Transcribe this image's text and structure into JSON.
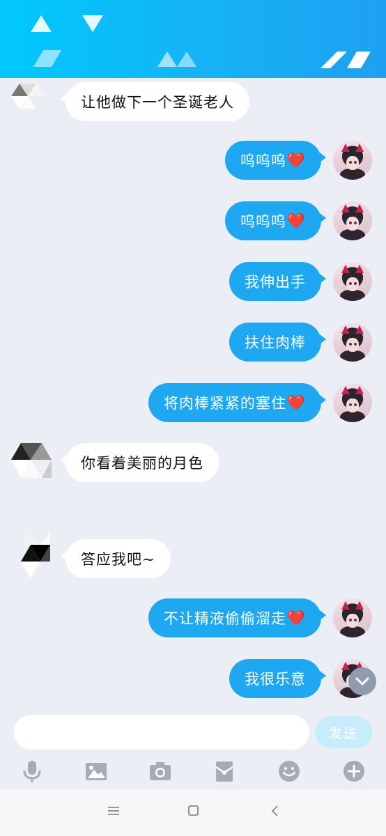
{
  "header": {
    "background_gradient": [
      "#00c8ff",
      "#1ea0f2"
    ]
  },
  "messages": [
    {
      "side": "left",
      "text": "让他做下一个圣诞老人",
      "heart": ""
    },
    {
      "side": "right",
      "text": "呜呜呜",
      "heart": "❤️"
    },
    {
      "side": "right",
      "text": "呜呜呜",
      "heart": "❤️"
    },
    {
      "side": "right",
      "text": "我伸出手",
      "heart": ""
    },
    {
      "side": "right",
      "text": "扶住肉棒",
      "heart": ""
    },
    {
      "side": "right",
      "text": "将肉棒紧紧的塞住",
      "heart": "❤️"
    },
    {
      "side": "left",
      "text": "你看着美丽的月色",
      "heart": ""
    },
    {
      "side": "left",
      "text": "答应我吧~",
      "heart": ""
    },
    {
      "side": "right",
      "text": "不让精液偷偷溜走",
      "heart": "❤️"
    },
    {
      "side": "right",
      "text": "我很乐意",
      "heart": ""
    }
  ],
  "input": {
    "value": "",
    "send_label": "发送"
  },
  "toolbar": {
    "icons": [
      "microphone-icon",
      "image-icon",
      "camera-icon",
      "red-packet-icon",
      "emoji-icon",
      "plus-icon"
    ]
  },
  "navbar": {
    "icons": [
      "menu-icon",
      "home-icon",
      "back-icon"
    ]
  },
  "colors": {
    "accent": "#1ea8f1",
    "background": "#eceef5",
    "send_button": "#c7ecfb",
    "scroll_button": "#8f9bb0",
    "icon_gray": "#a5acb8"
  }
}
